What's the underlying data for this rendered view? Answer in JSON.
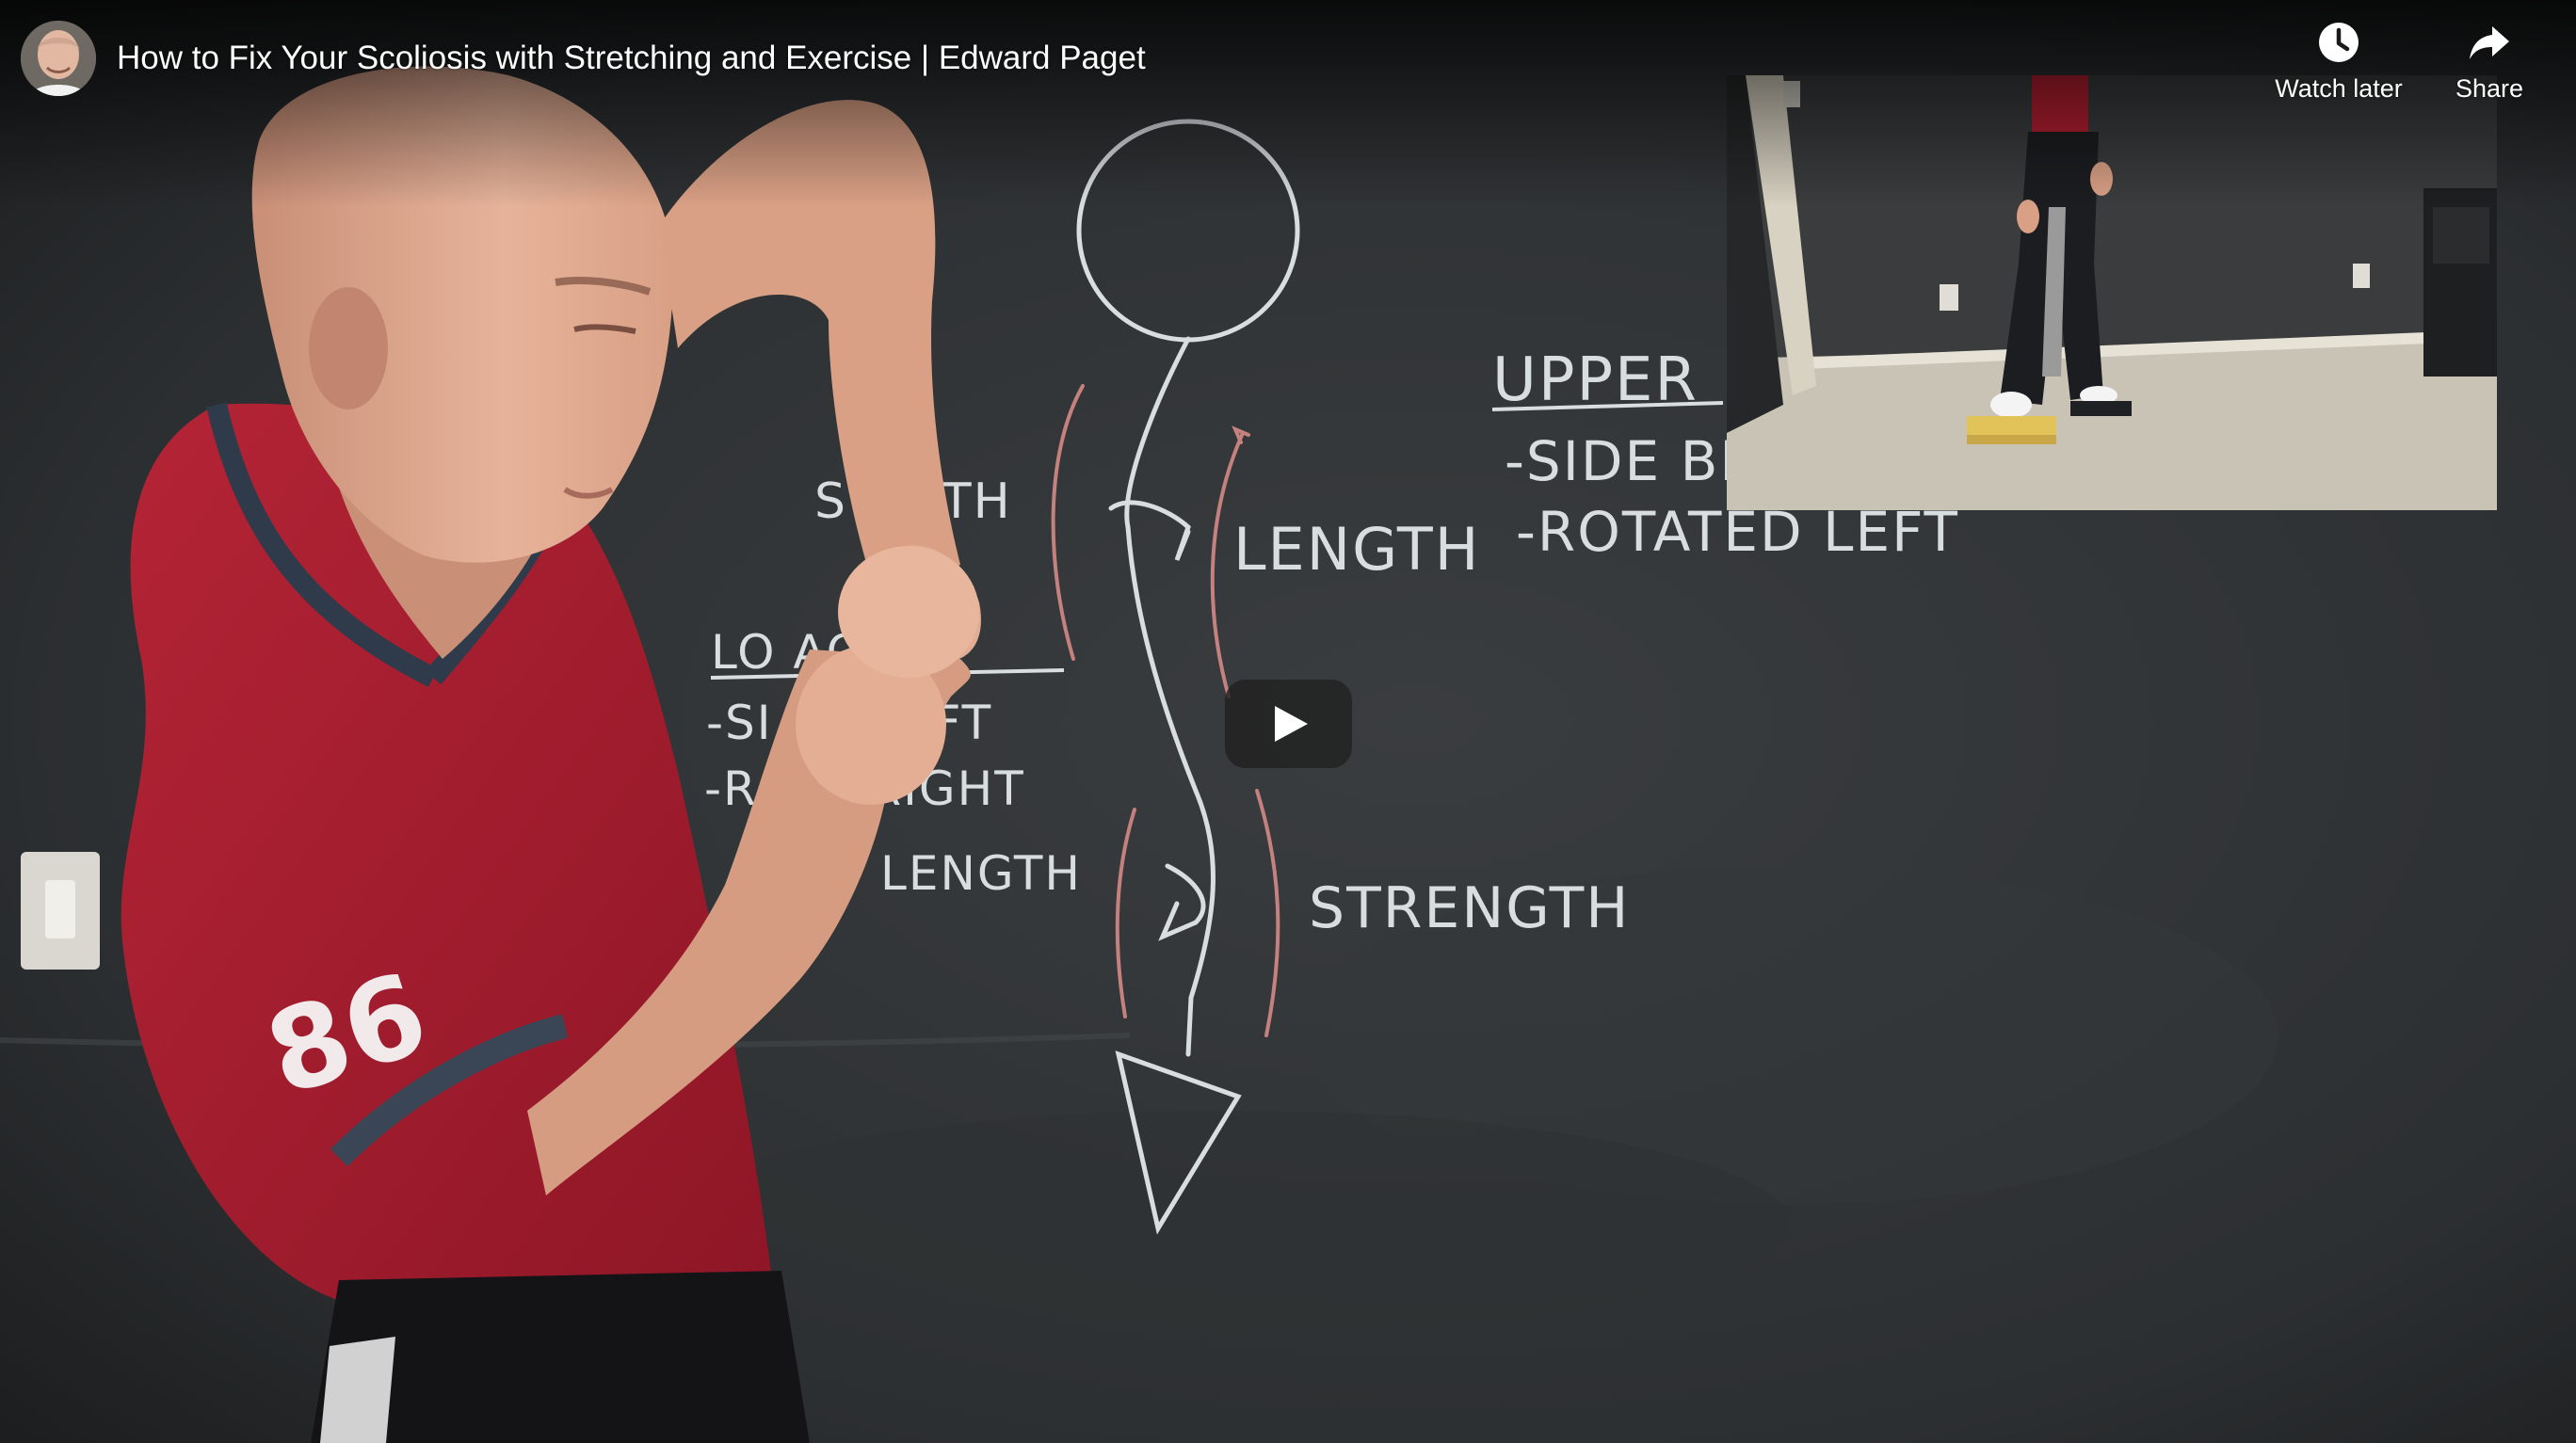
{
  "video": {
    "title": "How to Fix Your Scoliosis with Stretching and Exercise | Edward Paget"
  },
  "actions": {
    "watch_later": {
      "label": "Watch later",
      "icon": "clock-icon"
    },
    "share": {
      "label": "Share",
      "icon": "share-arrow-icon"
    }
  },
  "controls": {
    "play_icon": "play-icon"
  },
  "chalkboard": {
    "upper_heading": "UPPER",
    "upper_line1": "-SIDE BE",
    "upper_line2": "-ROTATED LEFT",
    "length_top": "LENGTH",
    "strength_top": "S     NGTH",
    "lower_heading": "LO       ACK",
    "lower_line1": "-SI       NT LEFT",
    "lower_line2": "-RO       D RIGHT",
    "length_bottom": "LENGTH",
    "strength_bottom": "STRENGTH"
  },
  "colors": {
    "chalkboard": "#2d3032",
    "shirt": "#a51e2e",
    "play_button_bg": "#212121",
    "text": "#ffffff"
  }
}
